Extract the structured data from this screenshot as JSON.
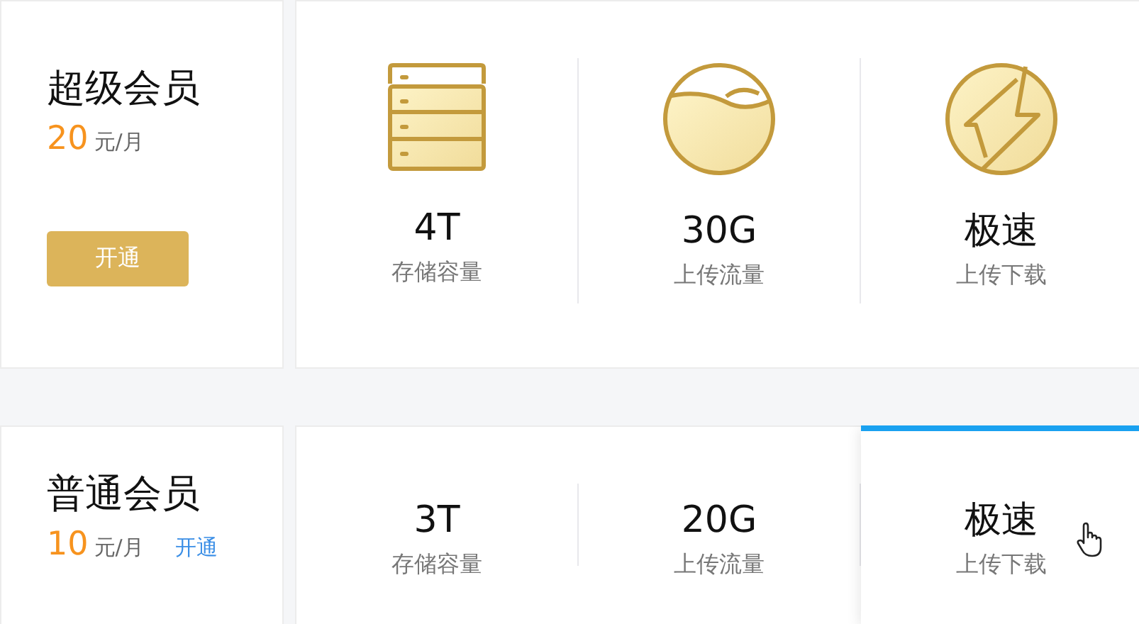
{
  "plans": [
    {
      "name": "超级会员",
      "price": "20",
      "unit": "元/月",
      "button": {
        "kind": "primary",
        "label": "开通"
      },
      "features": [
        {
          "kind": "storage",
          "value": "4T",
          "label": "存储容量",
          "highlighted": false
        },
        {
          "kind": "traffic",
          "value": "30G",
          "label": "上传流量",
          "highlighted": false
        },
        {
          "kind": "speed",
          "value": "极速",
          "label": "上传下载",
          "highlighted": false
        }
      ]
    },
    {
      "name": "普通会员",
      "price": "10",
      "unit": "元/月",
      "button": {
        "kind": "link",
        "label": "开通"
      },
      "features": [
        {
          "value": "3T",
          "label": "存储容量",
          "highlighted": false
        },
        {
          "value": "20G",
          "label": "上传流量",
          "highlighted": false
        },
        {
          "value": "极速",
          "label": "上传下载",
          "highlighted": true
        }
      ]
    }
  ]
}
